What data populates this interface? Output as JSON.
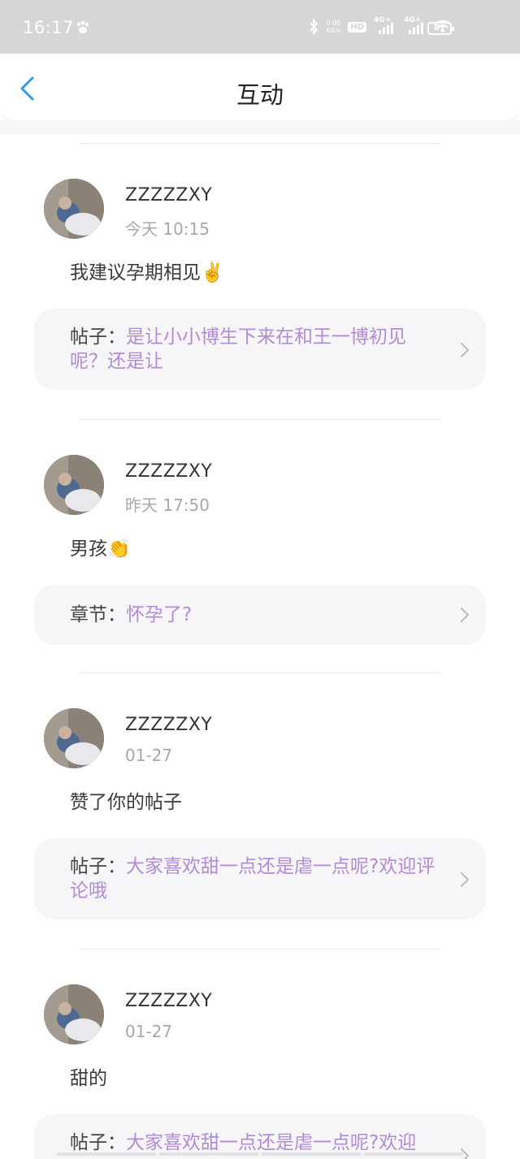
{
  "status_bar": {
    "time": "16:17",
    "speed_value": "0.00",
    "speed_unit": "KB/s",
    "hd_label": "HD",
    "signal1_label": "4G+",
    "signal2_label": "4G+",
    "battery": "87",
    "icons": [
      "paw-icon",
      "bluetooth-icon",
      "wifi-icon"
    ]
  },
  "header": {
    "title": "互动",
    "back_icon": "chevron-left-icon",
    "accent_color": "#2f9bf0"
  },
  "items": [
    {
      "username": "ZZZZZXY",
      "time": "今天  10:15",
      "comment": "我建议孕期相见✌️",
      "ref_label": "帖子：",
      "ref_title": "是让小小博生下来在和王一博初见呢？还是让"
    },
    {
      "username": "ZZZZZXY",
      "time": "昨天  17:50",
      "comment": "男孩👏",
      "ref_label": "章节：",
      "ref_title": "怀孕了?"
    },
    {
      "username": "ZZZZZXY",
      "time": "01-27",
      "comment": "赞了你的帖子",
      "ref_label": "帖子：",
      "ref_title": "大家喜欢甜一点还是虐一点呢?欢迎评论哦"
    },
    {
      "username": "ZZZZZXY",
      "time": "01-27",
      "comment": "甜的",
      "ref_label": "帖子：",
      "ref_title": "大家喜欢甜一点还是虐一点呢?欢迎"
    }
  ],
  "colors": {
    "ref_title": "#b28ad6",
    "card_bg": "#f6f6f8",
    "status_bar_bg": "#d6d6d6"
  }
}
